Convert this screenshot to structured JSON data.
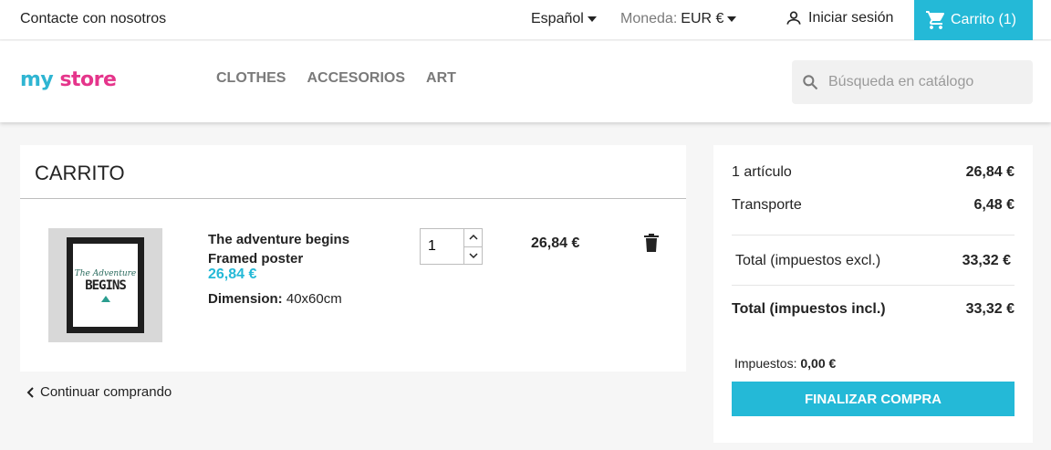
{
  "topbar": {
    "contact": "Contacte con nosotros",
    "language": "Español",
    "currency_label": "Moneda:",
    "currency_value": "EUR €",
    "signin": "Iniciar sesión",
    "cart": "Carrito (1)"
  },
  "header": {
    "logo": {
      "my": "my",
      "store": "store"
    },
    "menu": [
      "CLOTHES",
      "ACCESORIOS",
      "ART"
    ],
    "search_placeholder": "Búsqueda en catálogo"
  },
  "cart": {
    "title": "CARRITO",
    "item": {
      "name_line1": "The adventure begins",
      "name_line2": "Framed poster",
      "price": "26,84 €",
      "dimension_label": "Dimension:",
      "dimension_value": "40x60cm",
      "quantity": "1",
      "line_total": "26,84 €",
      "poster_text_top": "The Adventure",
      "poster_text_main": "BEGINS"
    },
    "continue": "Continuar comprando"
  },
  "summary": {
    "items_label": "1 artículo",
    "items_value": "26,84 €",
    "shipping_label": "Transporte",
    "shipping_value": "6,48 €",
    "total_excl_label": "Total (impuestos excl.)",
    "total_excl_value": "33,32 €",
    "total_incl_label": "Total (impuestos incl.)",
    "total_incl_value": "33,32 €",
    "tax_label": "Impuestos:",
    "tax_value": "0,00 €",
    "checkout": "FINALIZAR COMPRA"
  },
  "colors": {
    "accent": "#24b9d7",
    "text": "#232323",
    "muted": "#7a7a7a"
  },
  "icons": [
    "caret-down-icon",
    "person-icon",
    "cart-icon",
    "search-icon",
    "chevron-up-icon",
    "chevron-down-icon",
    "trash-icon",
    "chevron-left-icon"
  ]
}
